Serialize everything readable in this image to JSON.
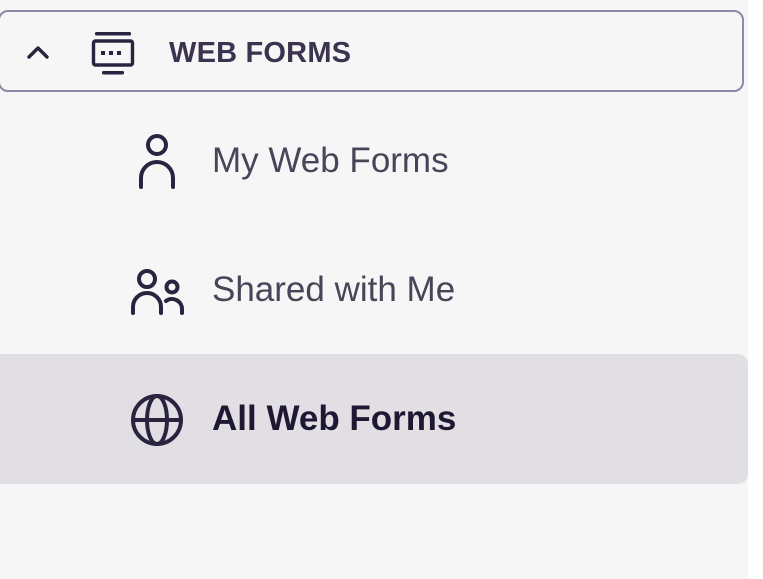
{
  "section": {
    "title": "WEB FORMS",
    "expanded": true,
    "icon": "web-forms-icon",
    "toggle_icon": "chevron-up-icon"
  },
  "nav": {
    "items": [
      {
        "label": "My Web Forms",
        "icon": "user-icon",
        "active": false
      },
      {
        "label": "Shared with Me",
        "icon": "users-icon",
        "active": false
      },
      {
        "label": "All Web Forms",
        "icon": "globe-icon",
        "active": true
      }
    ]
  },
  "colors": {
    "panel_bg": "#f6f6f6",
    "active_bg": "#e1dfe3",
    "border": "#8d88a3",
    "text": "#4a4458",
    "text_active": "#1f1833",
    "icon": "#2a2340"
  }
}
